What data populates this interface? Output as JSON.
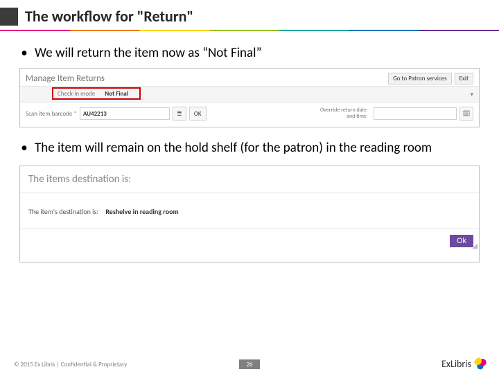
{
  "header": {
    "title": "The workflow for \"Return\""
  },
  "bullets": {
    "b1": "We will return the item now as “Not Final”",
    "b2": "The item will remain on the hold shelf (for the patron) in the reading room"
  },
  "shot1": {
    "title": "Manage Item Returns",
    "btn_patron": "Go to Patron services",
    "btn_exit": "Exit",
    "checkin_label": "Check-in mode",
    "checkin_value": "Not Final",
    "scan_label": "Scan item barcode *",
    "barcode_value": "AU42213",
    "ok_label": "OK",
    "override_label": "Override return date and time",
    "list_icon": "list-icon",
    "cal_icon": "calendar-icon",
    "caret_icon": "caret-down-icon"
  },
  "shot2": {
    "heading": "The items destination is:",
    "line_label": "The item's destination is:",
    "line_value": "Reshelve in reading room",
    "ok_label": "Ok"
  },
  "footer": {
    "copyright": "© 2015 Ex Libris | Confidential & Proprietary",
    "page": "26",
    "logo_text": "ExLibris"
  }
}
